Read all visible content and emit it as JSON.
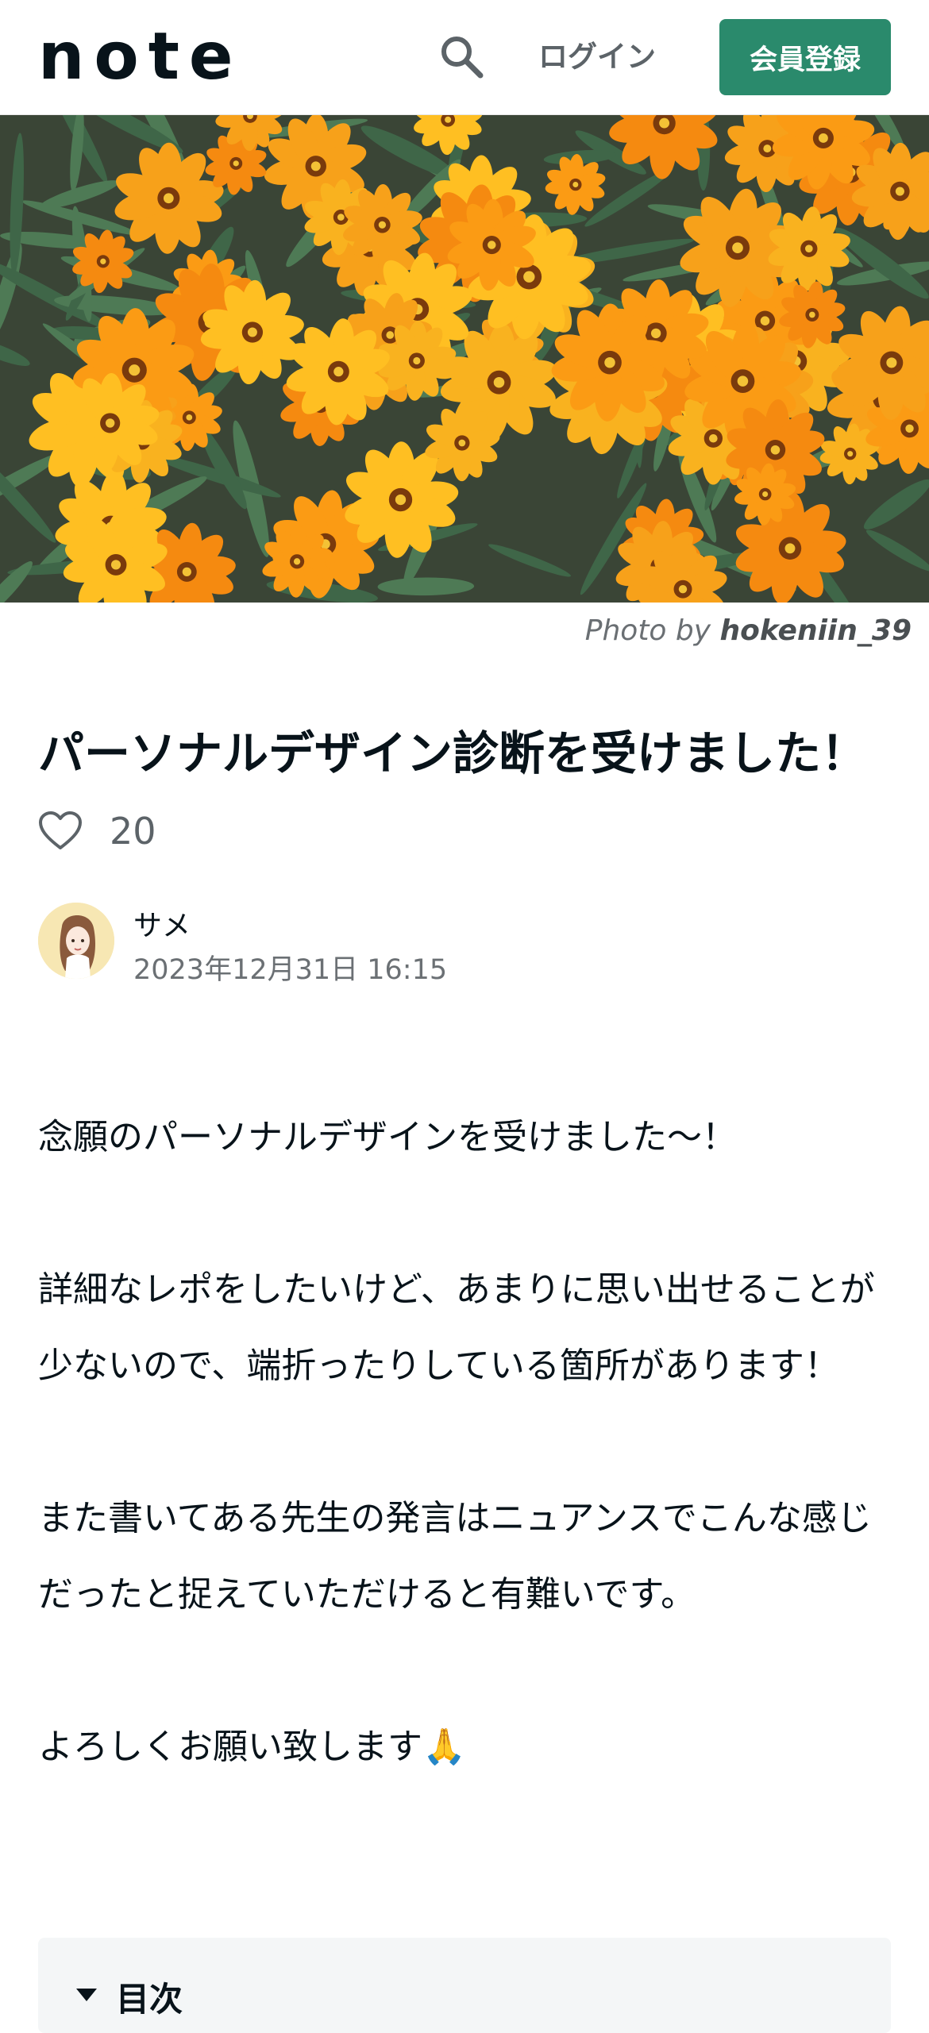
{
  "header": {
    "logo": "note",
    "login_label": "ログイン",
    "signup_label": "会員登録",
    "accent_color": "#2a8a6c"
  },
  "hero": {
    "photo_credit_prefix": "Photo by",
    "photo_credit_user": "hokeniin_39"
  },
  "article": {
    "title": "パーソナルデザイン診断を受けました！",
    "like_count": "20",
    "author_name": "サメ",
    "date": "2023年12月31日 16:15",
    "paragraphs": [
      "念願のパーソナルデザインを受けました〜！",
      "詳細なレポをしたいけど、あまりに思い出せることが少ないので、端折ったりしている箇所があります！",
      "また書いてある先生の発言はニュアンスでこんな感じだったと捉えていただけると有難いです。",
      "よろしくお願い致します🙏"
    ]
  },
  "toc": {
    "label": "目次"
  },
  "icons": {
    "search": "search-icon",
    "like": "heart-icon",
    "toc_caret": "caret-down-icon"
  }
}
